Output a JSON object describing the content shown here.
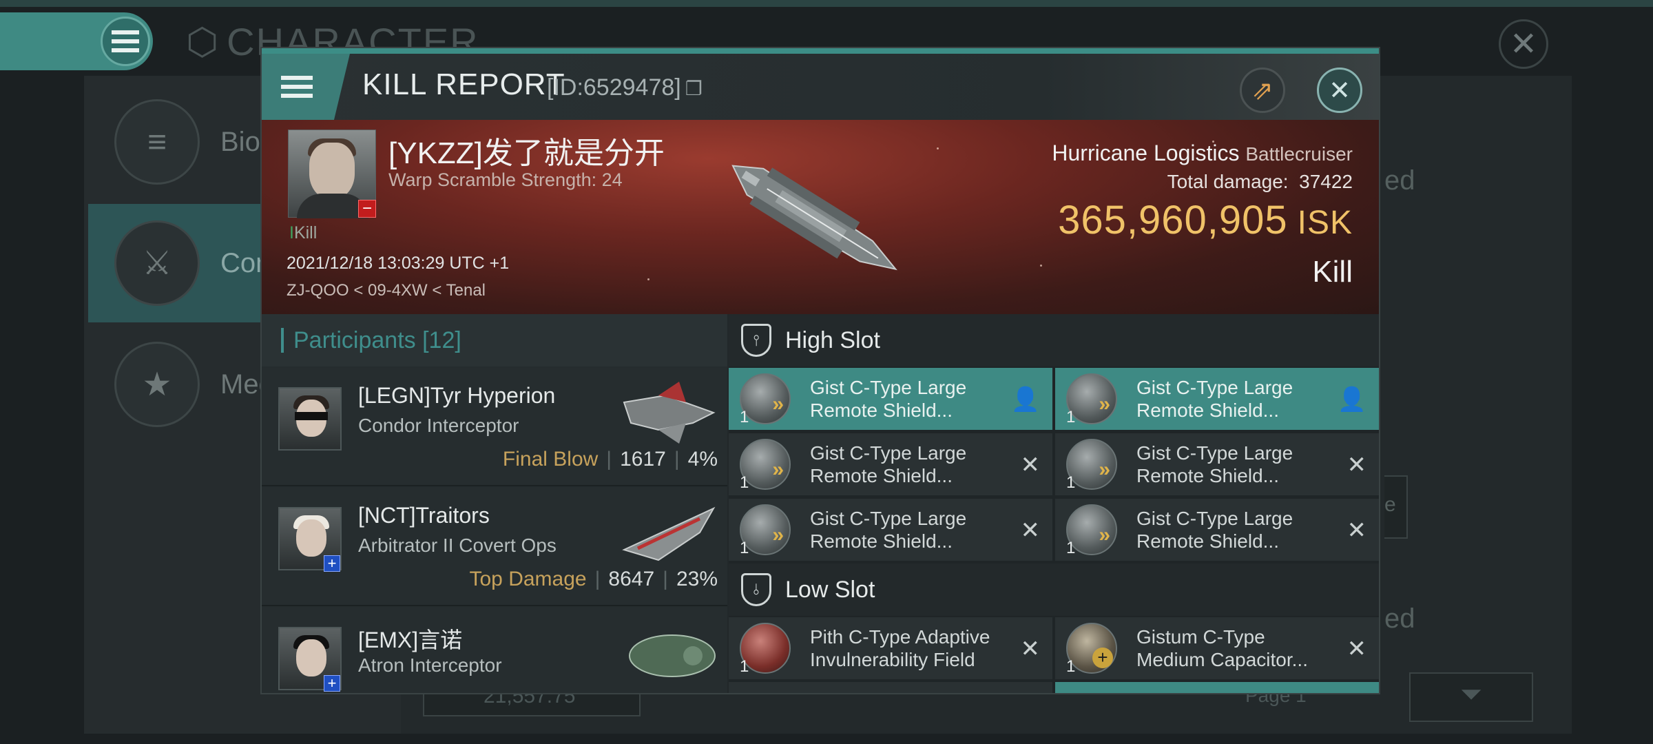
{
  "background": {
    "title": "CHARACTER",
    "menu_items": [
      {
        "label": "Bio",
        "icon": "menu-lines-icon"
      },
      {
        "label": "Comb",
        "icon": "crossed-swords-icon"
      },
      {
        "label": "Meda",
        "icon": "star-badge-icon"
      }
    ],
    "right_text_1": "ed",
    "right_text_2": "e",
    "right_text_3": "ed",
    "page_label": "Page 1",
    "wallet_value": "21,557.75",
    "arrow_right": "➔"
  },
  "modal": {
    "title": "KILL REPORT",
    "id_text": "[ID:6529478]",
    "copy_glyph": "❐",
    "share_glyph": "⇗",
    "close_glyph": "✕"
  },
  "victim": {
    "name": "[YKZZ]发了就是分开",
    "warp_scramble": "Warp Scramble Strength: 24",
    "kill_count_prefix": "I",
    "kill_count_label": "Kill",
    "datetime": "2021/12/18 13:03:29 UTC +1",
    "location": "ZJ-QOO < 09-4XW < Tenal",
    "ship_name": "Hurricane Logistics",
    "ship_class": "Battlecruiser",
    "total_damage_label": "Total damage:",
    "total_damage": "37422",
    "isk_value": "365,960,905",
    "isk_unit": "ISK",
    "result": "Kill",
    "minus_glyph": "−"
  },
  "participants": {
    "label": "Participants",
    "count": "[12]",
    "rows": [
      {
        "name": "[LEGN]Tyr Hyperion",
        "ship": "Condor Interceptor",
        "tag": "Final Blow",
        "damage": "1617",
        "percent": "4%",
        "badge": ""
      },
      {
        "name": "[NCT]Traitors",
        "ship": "Arbitrator II Covert Ops",
        "tag": "Top Damage",
        "damage": "8647",
        "percent": "23%",
        "badge": "+"
      },
      {
        "name": "[EMX]言诺",
        "ship": "Atron Interceptor",
        "tag": "",
        "damage": "",
        "percent": "",
        "badge": "+"
      }
    ],
    "separator": "|"
  },
  "slots": {
    "high_label": "High Slot",
    "low_label": "Low Slot",
    "high": [
      {
        "line1": "Gist C-Type Large",
        "line2": "Remote Shield...",
        "qty": "1",
        "action": "👤",
        "highlight": true
      },
      {
        "line1": "Gist C-Type Large",
        "line2": "Remote Shield...",
        "qty": "1",
        "action": "👤",
        "highlight": true
      },
      {
        "line1": "Gist C-Type Large",
        "line2": "Remote Shield...",
        "qty": "1",
        "action": "✕",
        "highlight": false
      },
      {
        "line1": "Gist C-Type Large",
        "line2": "Remote Shield...",
        "qty": "1",
        "action": "✕",
        "highlight": false
      },
      {
        "line1": "Gist C-Type Large",
        "line2": "Remote Shield...",
        "qty": "1",
        "action": "✕",
        "highlight": false
      },
      {
        "line1": "Gist C-Type Large",
        "line2": "Remote Shield...",
        "qty": "1",
        "action": "✕",
        "highlight": false
      }
    ],
    "low": [
      {
        "line1": "Pith C-Type Adaptive",
        "line2": "Invulnerability Field",
        "qty": "1",
        "action": "✕"
      },
      {
        "line1": "Gistum C-Type",
        "line2": "Medium Capacitor...",
        "qty": "1",
        "action": "✕"
      }
    ]
  },
  "colors": {
    "accent": "#3e8a84",
    "isk": "#f0c268",
    "banner": "#6a2620",
    "final_blow": "#c7a25c"
  }
}
